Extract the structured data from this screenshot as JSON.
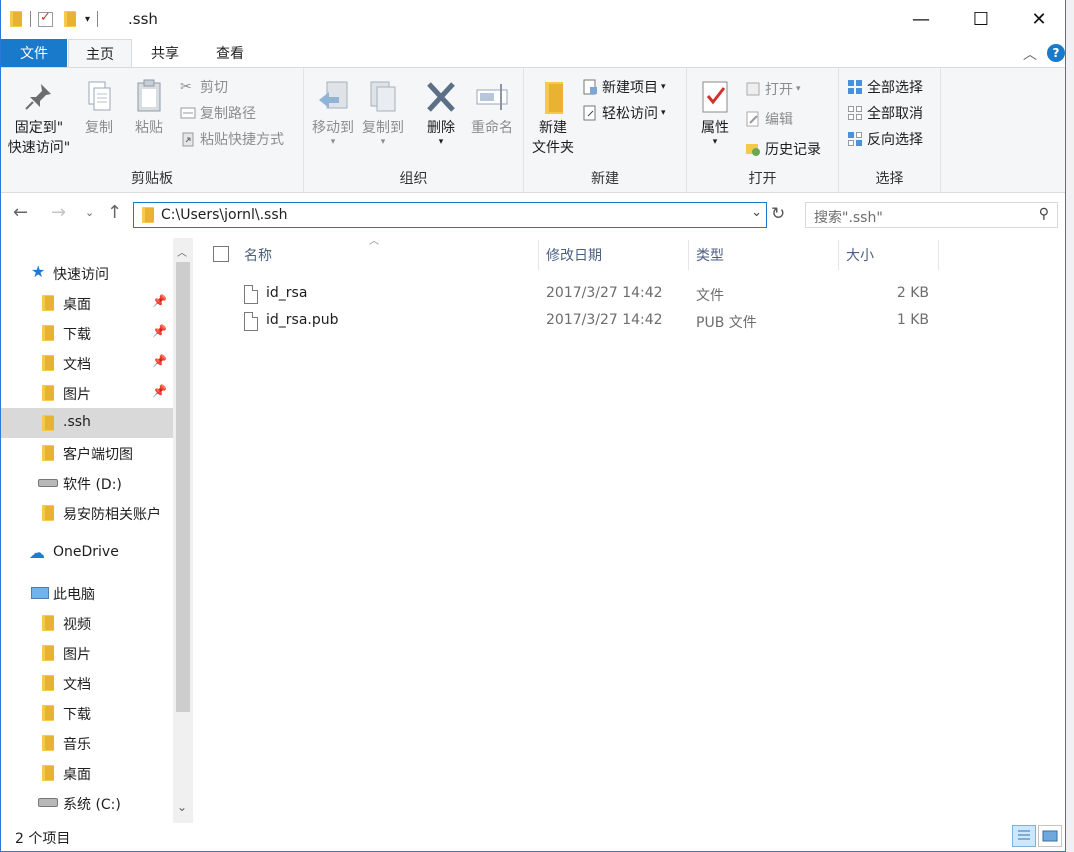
{
  "window": {
    "title": ".ssh",
    "minimize_glyph": "—",
    "maximize_glyph": "☐",
    "close_glyph": "✕"
  },
  "tabs": [
    {
      "label": "文件"
    },
    {
      "label": "主页"
    },
    {
      "label": "共享"
    },
    {
      "label": "查看"
    }
  ],
  "ribbon": {
    "clipboard": {
      "pin_label_1": "固定到\"",
      "pin_label_2": "快速访问\"",
      "copy": "复制",
      "paste": "粘贴",
      "cut": "剪切",
      "copy_path": "复制路径",
      "paste_shortcut": "粘贴快捷方式",
      "group": "剪贴板"
    },
    "organize": {
      "move_to": "移动到",
      "copy_to": "复制到",
      "delete": "删除",
      "rename": "重命名",
      "group": "组织"
    },
    "new": {
      "new_folder_1": "新建",
      "new_folder_2": "文件夹",
      "new_item": "新建项目",
      "easy_access": "轻松访问",
      "group": "新建"
    },
    "open": {
      "properties": "属性",
      "open": "打开",
      "edit": "编辑",
      "history": "历史记录",
      "group": "打开"
    },
    "select": {
      "select_all": "全部选择",
      "select_none": "全部取消",
      "invert": "反向选择",
      "group": "选择"
    }
  },
  "address": {
    "path": "C:\\Users\\jornl\\.ssh",
    "search_placeholder": "搜索\".ssh\""
  },
  "nav": {
    "quick_access": "快速访问",
    "items_quick": [
      {
        "label": "桌面"
      },
      {
        "label": "下载"
      },
      {
        "label": "文档"
      },
      {
        "label": "图片"
      },
      {
        "label": ".ssh"
      },
      {
        "label": "客户端切图"
      },
      {
        "label": "软件 (D:)"
      },
      {
        "label": "易安防相关账户"
      }
    ],
    "onedrive": "OneDrive",
    "this_pc": "此电脑",
    "items_pc": [
      {
        "label": "视频"
      },
      {
        "label": "图片"
      },
      {
        "label": "文档"
      },
      {
        "label": "下载"
      },
      {
        "label": "音乐"
      },
      {
        "label": "桌面"
      },
      {
        "label": "系统 (C:)"
      }
    ]
  },
  "columns": {
    "name": "名称",
    "date": "修改日期",
    "type": "类型",
    "size": "大小"
  },
  "files": [
    {
      "name": "id_rsa",
      "date": "2017/3/27 14:42",
      "type": "文件",
      "size": "2 KB"
    },
    {
      "name": "id_rsa.pub",
      "date": "2017/3/27 14:42",
      "type": "PUB 文件",
      "size": "1 KB"
    }
  ],
  "status": {
    "count": "2 个项目"
  },
  "colors": {
    "accent": "#1979ca",
    "folder": "#f7c94b",
    "selected_nav": "#d9d9d9"
  }
}
